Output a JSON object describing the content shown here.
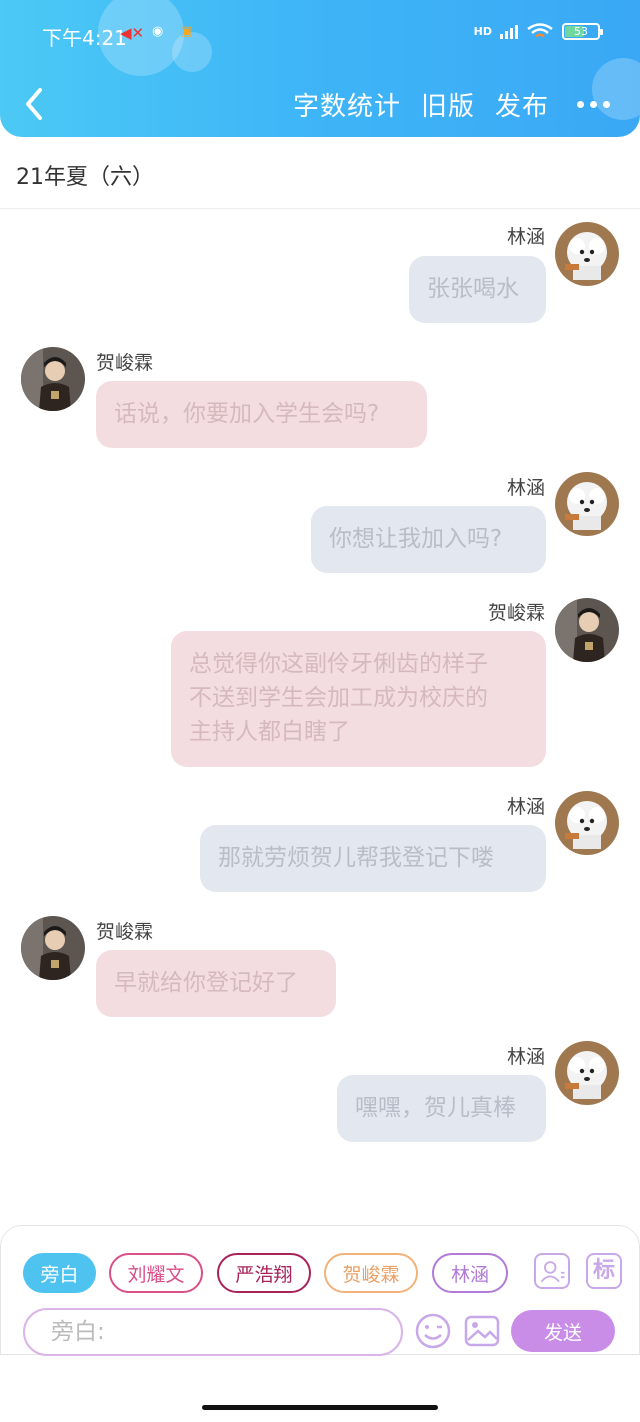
{
  "status_bar": {
    "time": "下午4:21",
    "network": "HD",
    "battery": "53"
  },
  "header": {
    "actions": [
      "字数统计",
      "旧版",
      "发布"
    ]
  },
  "page_title": "21年夏（六）",
  "messages": [
    {
      "speaker": "林涵",
      "text": "张张喝水",
      "side": "right",
      "style": "blue"
    },
    {
      "speaker": "贺峻霖",
      "text": "话说，你要加入学生会吗?",
      "side": "left",
      "style": "pink"
    },
    {
      "speaker": "林涵",
      "text": "你想让我加入吗?",
      "side": "right",
      "style": "blue"
    },
    {
      "speaker": "贺峻霖",
      "lines": [
        "总觉得你这副伶牙俐齿的样子",
        "不送到学生会加工成为校庆的",
        "主持人都白瞎了"
      ],
      "side": "right",
      "style": "pink"
    },
    {
      "speaker": "林涵",
      "text": "那就劳烦贺儿帮我登记下喽",
      "side": "right",
      "style": "blue"
    },
    {
      "speaker": "贺峻霖",
      "text": "早就给你登记好了",
      "side": "left",
      "style": "pink"
    },
    {
      "speaker": "林涵",
      "text": "嘿嘿，贺儿真棒",
      "side": "right",
      "style": "blue"
    }
  ],
  "role_chips": [
    {
      "label": "旁白",
      "color": "#4ec3f0",
      "selected": true
    },
    {
      "label": "刘耀文",
      "color": "#d94f8a",
      "selected": false
    },
    {
      "label": "严浩翔",
      "color": "#a8235a",
      "selected": false
    },
    {
      "label": "贺峻霖",
      "color": "#f2b27a",
      "selected": false
    },
    {
      "label": "林涵",
      "color": "#b07ad6",
      "selected": false
    }
  ],
  "tools": {
    "mark_label": "标"
  },
  "composer": {
    "placeholder": "旁白:",
    "send_label": "发送"
  },
  "colors": {
    "header": "#3fb6f7",
    "blue_bubble": "#e3e7ef",
    "pink_bubble": "#f3dde0",
    "send": "#c98de8"
  },
  "icons": [
    "back-arrow-icon",
    "more-icon",
    "role-card-icon",
    "mark-icon",
    "emoji-icon",
    "image-icon"
  ]
}
